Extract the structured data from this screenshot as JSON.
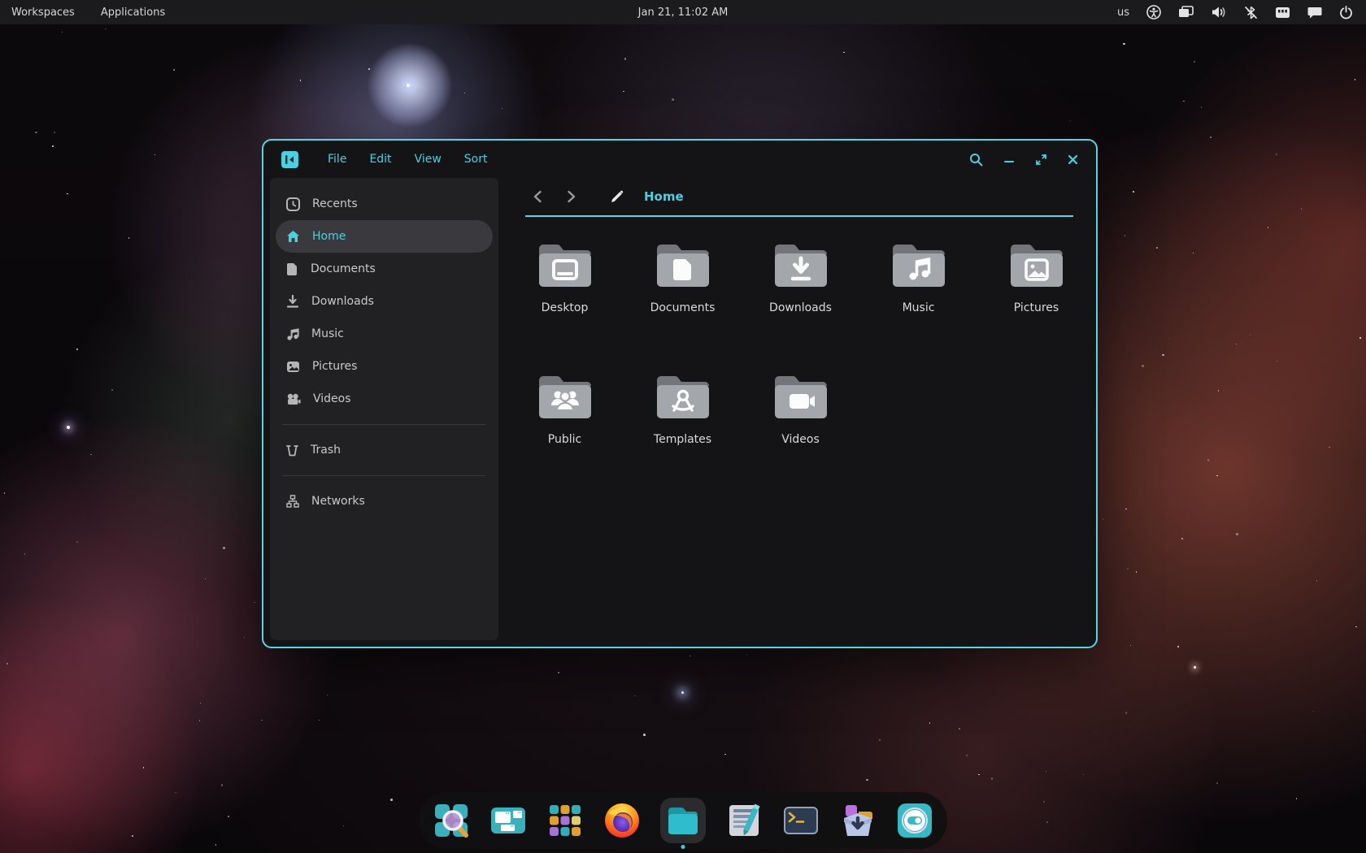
{
  "colors": {
    "accent": "#4ecfdf",
    "window_border": "#57d5e3",
    "topbar_bg": "#1b1b1d",
    "window_bg": "#141416",
    "sidebar_bg": "#212124",
    "selection_bg": "#3a3a3e",
    "folder_body": "#a3a6ab",
    "folder_tab": "#6f7176",
    "dock_bg": "#101011"
  },
  "topbar": {
    "left": [
      {
        "label": "Workspaces"
      },
      {
        "label": "Applications"
      }
    ],
    "clock": "Jan 21, 11:02 AM",
    "keyboard_layout": "us",
    "tray": [
      "accessibility",
      "displays",
      "volume",
      "bluetooth-disabled",
      "network-port",
      "chat",
      "power"
    ]
  },
  "window": {
    "app": "file-manager",
    "menus": [
      "File",
      "Edit",
      "View",
      "Sort"
    ],
    "controls": [
      "search",
      "minimize",
      "maximize",
      "close"
    ],
    "sidebar": {
      "items": [
        {
          "label": "Recents",
          "icon": "recents",
          "selected": false
        },
        {
          "label": "Home",
          "icon": "home",
          "selected": true
        },
        {
          "label": "Documents",
          "icon": "document",
          "selected": false
        },
        {
          "label": "Downloads",
          "icon": "download",
          "selected": false
        },
        {
          "label": "Music",
          "icon": "music",
          "selected": false
        },
        {
          "label": "Pictures",
          "icon": "picture",
          "selected": false
        },
        {
          "label": "Videos",
          "icon": "video",
          "selected": false
        }
      ],
      "trash": {
        "label": "Trash",
        "icon": "trash"
      },
      "networks": {
        "label": "Networks",
        "icon": "network-tree"
      }
    },
    "pathbar": {
      "location": "Home",
      "nav": [
        "back",
        "forward",
        "rename"
      ]
    },
    "folders": [
      {
        "name": "Desktop",
        "glyph": "monitor"
      },
      {
        "name": "Documents",
        "glyph": "document"
      },
      {
        "name": "Downloads",
        "glyph": "download-arrow"
      },
      {
        "name": "Music",
        "glyph": "music-notes"
      },
      {
        "name": "Pictures",
        "glyph": "photo"
      },
      {
        "name": "Public",
        "glyph": "people"
      },
      {
        "name": "Templates",
        "glyph": "compass"
      },
      {
        "name": "Videos",
        "glyph": "camera"
      }
    ]
  },
  "dock": {
    "items": [
      "app-finder",
      "workspace-overview",
      "app-grid",
      "firefox",
      "files",
      "text-editor",
      "terminal",
      "software-installer",
      "settings-toggles"
    ],
    "active_item": "files"
  }
}
